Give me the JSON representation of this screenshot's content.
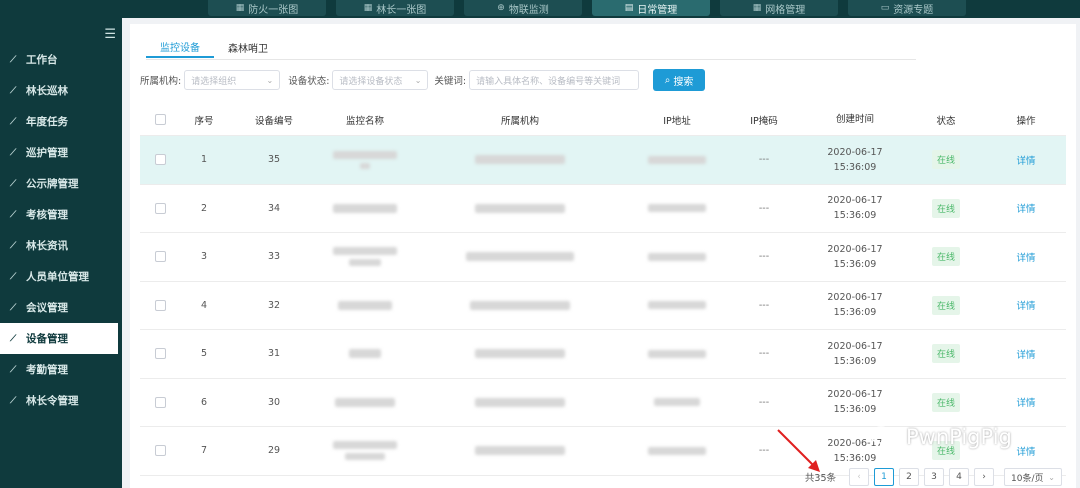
{
  "topnav": {
    "tabs": [
      {
        "label": "防火一张图",
        "icon": "map-icon",
        "glyph": "▦"
      },
      {
        "label": "林长一张图",
        "icon": "map-icon",
        "glyph": "▦"
      },
      {
        "label": "物联监测",
        "icon": "globe-icon",
        "glyph": "⊕"
      },
      {
        "label": "日常管理",
        "icon": "calendar-icon",
        "glyph": "▤",
        "active": true
      },
      {
        "label": "网格管理",
        "icon": "grid-icon",
        "glyph": "▦"
      },
      {
        "label": "资源专题",
        "icon": "folder-icon",
        "glyph": "▭"
      }
    ]
  },
  "sidebar": {
    "collapse_icon": "collapse-menu-icon",
    "items": [
      {
        "label": "工作台"
      },
      {
        "label": "林长巡林"
      },
      {
        "label": "年度任务"
      },
      {
        "label": "巡护管理"
      },
      {
        "label": "公示牌管理"
      },
      {
        "label": "考核管理"
      },
      {
        "label": "林长资讯"
      },
      {
        "label": "人员单位管理"
      },
      {
        "label": "会议管理"
      },
      {
        "label": "设备管理",
        "active": true
      },
      {
        "label": "考勤管理"
      },
      {
        "label": "林长令管理"
      }
    ]
  },
  "subtabs": [
    {
      "label": "监控设备",
      "active": true
    },
    {
      "label": "森林哨卫"
    }
  ],
  "filters": {
    "org_label": "所属机构:",
    "org_placeholder": "请选择组织",
    "status_label": "设备状态:",
    "status_placeholder": "请选择设备状态",
    "keyword_label": "关键词:",
    "keyword_placeholder": "请输入具体名称、设备编号等关键词",
    "search_label": "搜索"
  },
  "table": {
    "columns": [
      "序号",
      "设备编号",
      "监控名称",
      "所属机构",
      "IP地址",
      "IP掩码",
      "创建时间",
      "状态",
      "操作"
    ],
    "rows": [
      {
        "no": "1",
        "code": "35",
        "mask": "---",
        "date": "2020-06-17",
        "time": "15:36:09",
        "status": "在线",
        "op": "详情"
      },
      {
        "no": "2",
        "code": "34",
        "mask": "---",
        "date": "2020-06-17",
        "time": "15:36:09",
        "status": "在线",
        "op": "详情"
      },
      {
        "no": "3",
        "code": "33",
        "mask": "---",
        "date": "2020-06-17",
        "time": "15:36:09",
        "status": "在线",
        "op": "详情"
      },
      {
        "no": "4",
        "code": "32",
        "mask": "---",
        "date": "2020-06-17",
        "time": "15:36:09",
        "status": "在线",
        "op": "详情"
      },
      {
        "no": "5",
        "code": "31",
        "mask": "---",
        "date": "2020-06-17",
        "time": "15:36:09",
        "status": "在线",
        "op": "详情"
      },
      {
        "no": "6",
        "code": "30",
        "mask": "---",
        "date": "2020-06-17",
        "time": "15:36:09",
        "status": "在线",
        "op": "详情"
      },
      {
        "no": "7",
        "code": "29",
        "mask": "---",
        "date": "2020-06-17",
        "time": "15:36:09",
        "status": "在线",
        "op": "详情"
      }
    ]
  },
  "pagination": {
    "total": "共35条",
    "pages": [
      "1",
      "2",
      "3",
      "4"
    ],
    "current": "1",
    "prev": "‹",
    "next": "›",
    "page_size": "10条/页"
  },
  "watermark": {
    "text": "PwnPigPig"
  },
  "colors": {
    "accent": "#1e9bd6",
    "sidebar": "#0f3a3d",
    "online": "#4ab869",
    "highlight": "#e2f5f4"
  }
}
